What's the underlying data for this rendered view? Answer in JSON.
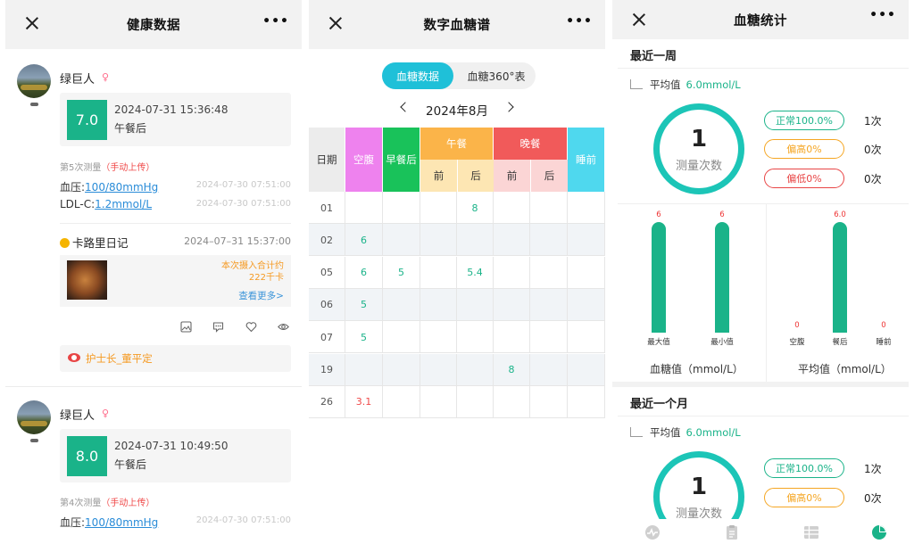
{
  "panel1": {
    "title": "健康数据",
    "posts": [
      {
        "user": "绿巨人",
        "gender": "♀",
        "value": "7.0",
        "datetime": "2024-07-31 15:36:48",
        "meal": "午餐后",
        "measure_label": "第5次测量",
        "measure_source": "（手动上传）",
        "bp_label": "血压:",
        "bp_value": "100/80mmHg",
        "bp_time": "2024-07-30 07:51:00",
        "ldl_label": "LDL-C:",
        "ldl_value": "1.2mmol/L",
        "ldl_time": "2024-07-30 07:51:00"
      },
      {
        "user": "绿巨人",
        "gender": "♀",
        "value": "8.0",
        "datetime": "2024-07-31 10:49:50",
        "meal": "午餐后",
        "measure_label": "第4次测量",
        "measure_source": "（手动上传）",
        "bp_label": "血压:",
        "bp_value": "100/80mmHg",
        "bp_time": "2024-07-30 07:51:00"
      }
    ],
    "diary": {
      "title": "卡路里日记",
      "time": "2024–07–31 15:37:00",
      "kcal_line1": "本次摄入合计约",
      "kcal_line2": "222千卡",
      "more": "查看更多>"
    },
    "nurse": "护士长_董平定",
    "action_icons": [
      "image-icon",
      "comment-icon",
      "heart-icon",
      "eye-icon"
    ]
  },
  "panel2": {
    "title": "数字血糖谱",
    "tabs": [
      "血糖数据",
      "血糖360°表"
    ],
    "month": "2024年8月",
    "headers": {
      "date": "日期",
      "fasting": "空腹",
      "after_breakfast": "早餐后",
      "lunch": "午餐",
      "dinner": "晚餐",
      "before": "前",
      "after": "后",
      "bedtime": "睡前"
    },
    "rows": [
      {
        "date": "01",
        "fasting": "",
        "after_breakfast": "",
        "lunch_before": "",
        "lunch_after": "8",
        "dinner_before": "",
        "dinner_after": "",
        "bedtime": ""
      },
      {
        "date": "02",
        "fasting": "6",
        "after_breakfast": "",
        "lunch_before": "",
        "lunch_after": "",
        "dinner_before": "",
        "dinner_after": "",
        "bedtime": ""
      },
      {
        "date": "05",
        "fasting": "6",
        "after_breakfast": "5",
        "lunch_before": "",
        "lunch_after": "5.4",
        "dinner_before": "",
        "dinner_after": "",
        "bedtime": ""
      },
      {
        "date": "06",
        "fasting": "5",
        "after_breakfast": "",
        "lunch_before": "",
        "lunch_after": "",
        "dinner_before": "",
        "dinner_after": "",
        "bedtime": ""
      },
      {
        "date": "07",
        "fasting": "5",
        "after_breakfast": "",
        "lunch_before": "",
        "lunch_after": "",
        "dinner_before": "",
        "dinner_after": "",
        "bedtime": ""
      },
      {
        "date": "19",
        "fasting": "",
        "after_breakfast": "",
        "lunch_before": "",
        "lunch_after": "",
        "dinner_before": "8",
        "dinner_after": "",
        "bedtime": ""
      },
      {
        "date": "26",
        "fasting": "3.1",
        "after_breakfast": "",
        "lunch_before": "",
        "lunch_after": "",
        "dinner_before": "",
        "dinner_after": "",
        "bedtime": ""
      }
    ],
    "colors": {
      "fasting": "#ee82ee",
      "after_breakfast": "#19c25a",
      "lunch": "#fbb449",
      "lunch_sub": "#fde6b3",
      "dinner": "#f15a5a",
      "dinner_sub": "#fbd5d5",
      "bedtime": "#4fd8ee",
      "value_green": "#1ab389",
      "value_red": "#f04a4a"
    }
  },
  "panel3": {
    "title": "血糖统计",
    "week": {
      "section": "最近一周",
      "avg_label": "平均值",
      "avg_value": "6.0mmol/L",
      "count": "1",
      "count_label": "测量次数",
      "normal": "正常100.0%",
      "normal_count": "1次",
      "high": "偏高0%",
      "high_count": "0次",
      "low": "偏低0%",
      "low_count": "0次"
    },
    "month": {
      "section": "最近一个月",
      "avg_label": "平均值",
      "avg_value": "6.0mmol/L",
      "count": "1",
      "count_label": "测量次数",
      "normal": "正常100.0%",
      "normal_count": "1次",
      "high": "偏高0%",
      "high_count": "0次"
    },
    "chart_data": [
      {
        "type": "bar",
        "categories": [
          "最大值",
          "最小值"
        ],
        "values": [
          6,
          6
        ],
        "value_labels": [
          "6",
          "6"
        ],
        "xlabel": "血糖值（mmol/L）"
      },
      {
        "type": "bar",
        "categories": [
          "空腹",
          "餐后",
          "睡前"
        ],
        "values": [
          0,
          6.0,
          0
        ],
        "value_labels": [
          "0",
          "6.0",
          "0"
        ],
        "xlabel": "平均值（mmol/L）"
      }
    ],
    "tabbar_icons": [
      "trend-icon",
      "clipboard-icon",
      "table-icon",
      "pie-chart-icon"
    ]
  }
}
